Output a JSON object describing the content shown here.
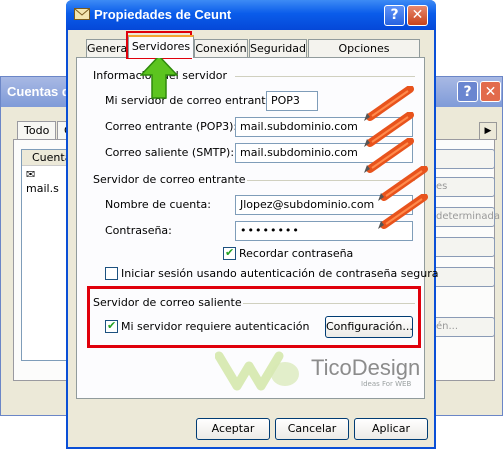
{
  "background_window": {
    "title": "Cuentas d",
    "tabs": [
      "Todo",
      "C"
    ],
    "list_header": "Cuenta",
    "list_item": "mail.s",
    "buttons": [
      "",
      "es",
      "determinada",
      "",
      "",
      "én..."
    ]
  },
  "dialog": {
    "title": "Propiedades de Ceunt",
    "tabs": [
      "General",
      "Servidores",
      "Conexión",
      "Seguridad",
      "Opciones avanzadas"
    ],
    "active_tab": "Servidores",
    "server_info": {
      "heading": "Información del servidor",
      "incoming_type_label": "Mi servidor de correo entrante es",
      "incoming_type_value": "POP3",
      "incoming_label": "Correo entrante (POP3):",
      "incoming_value": "mail.subdominio.com",
      "outgoing_label": "Correo saliente (SMTP):",
      "outgoing_value": "mail.subdominio.com"
    },
    "incoming_server": {
      "heading": "Servidor de correo entrante",
      "account_label": "Nombre de cuenta:",
      "account_value": "Jlopez@subdominio.com",
      "password_label": "Contraseña:",
      "password_value": "••••••••",
      "remember_label": "Recordar contraseña",
      "remember_checked": true,
      "spa_label": "Iniciar sesión usando autenticación de contraseña segura",
      "spa_checked": false
    },
    "outgoing_server": {
      "heading": "Servidor de correo saliente",
      "auth_label": "Mi servidor requiere autenticación",
      "auth_checked": true,
      "settings_button": "Configuración..."
    },
    "buttons": {
      "ok": "Aceptar",
      "cancel": "Cancelar",
      "apply": "Aplicar"
    }
  },
  "watermark": {
    "brand": "TicoDesign",
    "tagline": "Ideas For WEB"
  },
  "colors": {
    "highlight": "#e0000b",
    "arrow": "#5cc41f",
    "pencil": "#e8531c"
  }
}
